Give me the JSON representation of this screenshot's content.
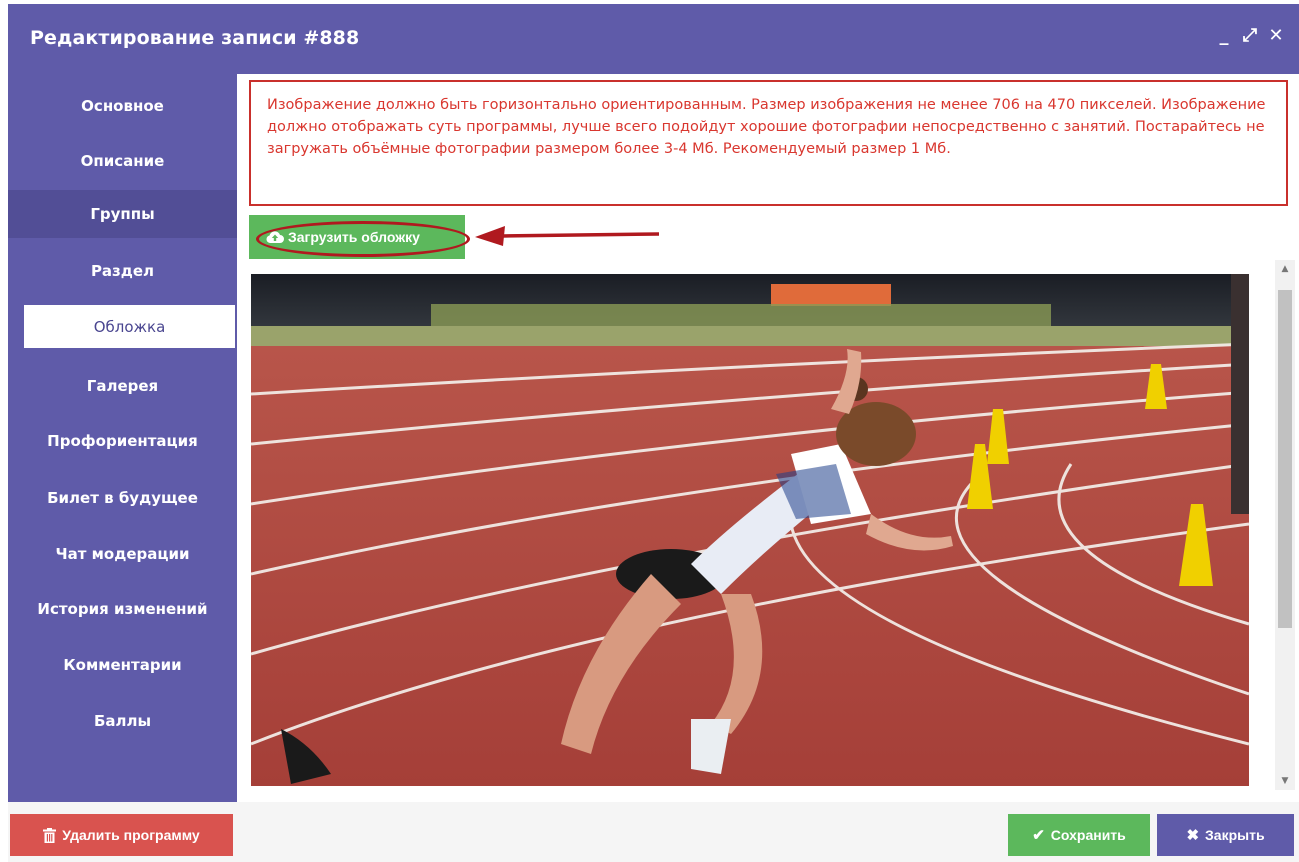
{
  "window": {
    "title": "Редактирование записи #888",
    "controls": {
      "minimize": "_",
      "maximize": "⤢",
      "close": "✕"
    }
  },
  "sidebar": {
    "items": [
      {
        "label": "Основное"
      },
      {
        "label": "Описание"
      },
      {
        "label": "Группы"
      },
      {
        "label": "Раздел"
      },
      {
        "label": "Обложка"
      },
      {
        "label": "Галерея"
      },
      {
        "label": "Профориентация"
      },
      {
        "label": "Билет в будущее"
      },
      {
        "label": "Чат модерации"
      },
      {
        "label": "История изменений"
      },
      {
        "label": "Комментарии"
      },
      {
        "label": "Баллы"
      }
    ],
    "active": "Обложка",
    "hovered": "Группы"
  },
  "main": {
    "notice": "Изображение должно быть горизонтально ориентированным. Размер изображения не менее 706 на 470 пикселей. Изображение должно отображать суть программы, лучше всего подойдут хорошие фотографии непосредственно с занятий. Постарайтесь не загружать объёмные фотографии размером более 3-4 Мб. Рекомендуемый размер 1 Мб.",
    "upload_button": "Загрузить обложку"
  },
  "footer": {
    "delete_label": "Удалить программу",
    "save_label": "Сохранить",
    "close_label": "Закрыть"
  },
  "colors": {
    "accent": "#5f5ba9",
    "success": "#5cb85c",
    "danger": "#d9534f",
    "alert_text": "#d9372f"
  },
  "icons": {
    "upload": "cloud-upload-icon",
    "delete": "trash-icon",
    "save": "check-icon",
    "close": "close-icon"
  }
}
